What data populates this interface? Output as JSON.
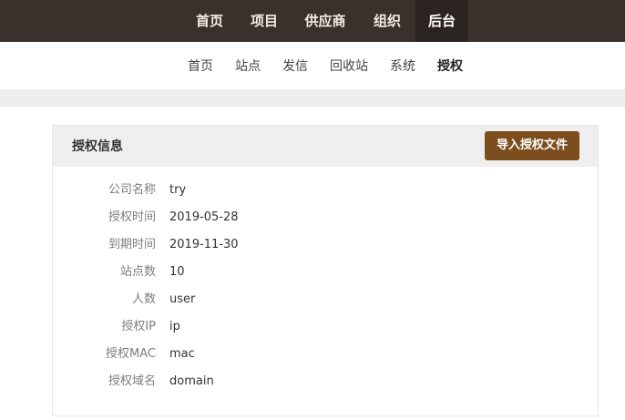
{
  "top_nav": {
    "items": [
      {
        "label": "首页"
      },
      {
        "label": "项目"
      },
      {
        "label": "供应商"
      },
      {
        "label": "组织"
      },
      {
        "label": "后台",
        "active": true
      }
    ]
  },
  "sub_nav": {
    "items": [
      {
        "label": "首页"
      },
      {
        "label": "站点"
      },
      {
        "label": "发信"
      },
      {
        "label": "回收站"
      },
      {
        "label": "系统"
      },
      {
        "label": "授权",
        "active": true
      }
    ]
  },
  "panel": {
    "title": "授权信息",
    "import_button_label": "导入授权文件",
    "fields": [
      {
        "label": "公司名称",
        "value": "try"
      },
      {
        "label": "授权时间",
        "value": "2019-05-28"
      },
      {
        "label": "到期时间",
        "value": "2019-11-30"
      },
      {
        "label": "站点数",
        "value": "10"
      },
      {
        "label": "人数",
        "value": "user"
      },
      {
        "label": "授权IP",
        "value": "ip"
      },
      {
        "label": "授权MAC",
        "value": "mac"
      },
      {
        "label": "授权域名",
        "value": "domain"
      }
    ]
  },
  "colors": {
    "top_nav_bg": "#3a302c",
    "top_nav_active_bg": "#2b2421",
    "button_bg": "#7d4e1d"
  }
}
